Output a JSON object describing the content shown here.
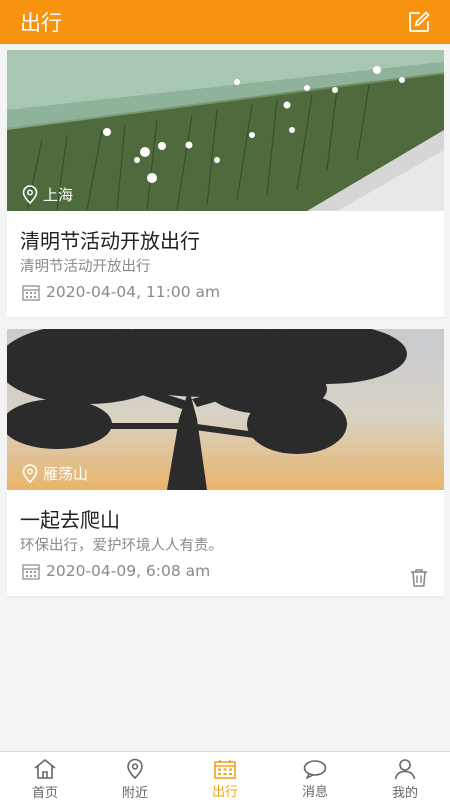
{
  "header": {
    "title": "出行",
    "edit_icon": "edit-icon"
  },
  "posts": [
    {
      "location": "上海",
      "title": "清明节活动开放出行",
      "description": "清明节活动开放出行",
      "date": "2020-04-04, 11:00 am",
      "deletable": false
    },
    {
      "location": "雁荡山",
      "title": "一起去爬山",
      "description": "环保出行，爱护环境人人有责。",
      "date": "2020-04-09, 6:08 am",
      "deletable": true
    }
  ],
  "tabbar": {
    "items": [
      {
        "label": "首页",
        "icon": "home-icon"
      },
      {
        "label": "附近",
        "icon": "location-pin-icon"
      },
      {
        "label": "出行",
        "icon": "calendar-icon",
        "active": true
      },
      {
        "label": "消息",
        "icon": "chat-bubble-icon"
      },
      {
        "label": "我的",
        "icon": "user-icon"
      }
    ]
  },
  "colors": {
    "accent": "#f7930e",
    "tab_active": "#f0a21a",
    "text_secondary": "#8a8a8a"
  }
}
